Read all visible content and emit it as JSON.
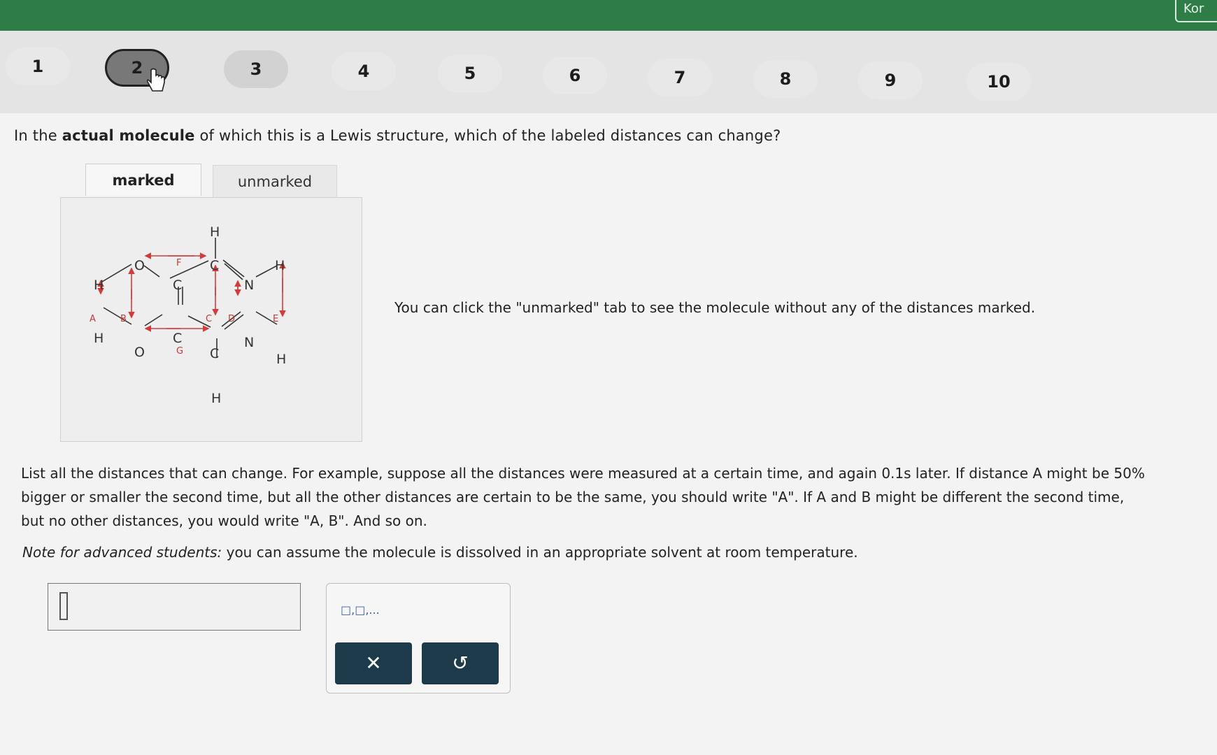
{
  "topbar": {
    "button_label": "Kor"
  },
  "steps": [
    "1",
    "2",
    "3",
    "4",
    "5",
    "6",
    "7",
    "8",
    "9",
    "10"
  ],
  "question": {
    "pre": "In the ",
    "bold": "actual molecule",
    "post": " of which this is a Lewis structure, which of the labeled distances can change?"
  },
  "tabs": {
    "marked": "marked",
    "unmarked": "unmarked"
  },
  "molecule": {
    "atoms": {
      "O1": "O",
      "O2": "O",
      "C1": "C",
      "C2": "C",
      "C3": "C",
      "C4": "C",
      "N1": "N",
      "N2": "N",
      "H": "H"
    },
    "distance_labels": [
      "A",
      "B",
      "C",
      "D",
      "E",
      "F",
      "G"
    ]
  },
  "aside_text": "You can click the \"unmarked\" tab to see the molecule without any of the distances marked.",
  "instructions": {
    "line1": "List all the distances that can change. For example, suppose all the distances were measured at a certain time, and again 0.1s later. If distance A might be 50%",
    "line2": "bigger or smaller the second time, but all the other distances are certain to be the same, you should write \"A\". If A and B might be different the second time,",
    "line3": "but no other distances, you would write \"A, B\". And so on."
  },
  "note": {
    "label": "Note for advanced students:",
    "text": " you can assume the molecule is dissolved in an appropriate solvent at room temperature."
  },
  "answer": {
    "value": ""
  },
  "toolbox": {
    "format_icon": "□,□,...",
    "clear_label": "✕",
    "undo_label": "↺"
  },
  "colors": {
    "topbar": "#2f7d46",
    "distance_arrows": "#d33c3c",
    "action_button": "#1d3a4a"
  }
}
